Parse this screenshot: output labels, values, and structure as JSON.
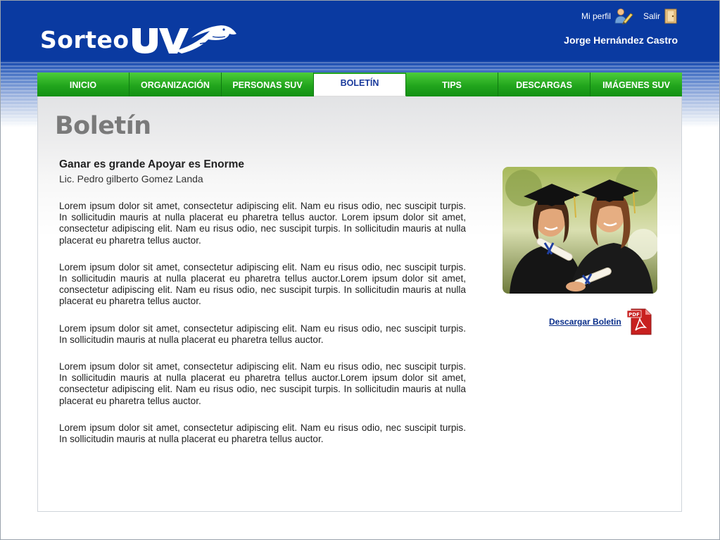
{
  "header": {
    "logo_text": "Sorteo",
    "profile_label": "Mi perfil",
    "logout_label": "Salir",
    "user_name": "Jorge Hernández Castro"
  },
  "nav": {
    "items": [
      {
        "label": "INICIO"
      },
      {
        "label": "ORGANIZACIÓN"
      },
      {
        "label": "PERSONAS SUV"
      },
      {
        "label": "BOLETÍN",
        "active": true
      },
      {
        "label": "TIPS"
      },
      {
        "label": "DESCARGAS"
      },
      {
        "label": "IMÁGENES SUV"
      }
    ]
  },
  "page": {
    "title": "Boletín"
  },
  "article": {
    "title": "Ganar es grande Apoyar es Enorme",
    "author": "Lic. Pedro gilberto Gomez Landa",
    "paragraphs": [
      "Lorem ipsum dolor sit amet, consectetur adipiscing elit. Nam eu risus odio, nec suscipit turpis. In sollicitudin mauris at nulla placerat eu pharetra tellus auctor. Lorem ipsum dolor sit amet, consectetur adipiscing elit. Nam eu risus odio, nec suscipit turpis. In sollicitudin mauris at nulla placerat eu pharetra tellus auctor.",
      "Lorem ipsum dolor sit amet, consectetur adipiscing elit. Nam eu risus odio, nec suscipit turpis. In sollicitudin mauris at nulla placerat eu pharetra tellus auctor.Lorem ipsum dolor sit amet, consectetur adipiscing elit. Nam eu risus odio, nec suscipit turpis. In sollicitudin mauris at nulla placerat eu pharetra tellus auctor.",
      "Lorem ipsum dolor sit amet, consectetur adipiscing elit. Nam eu risus odio, nec suscipit turpis. In sollicitudin mauris at nulla placerat eu pharetra tellus auctor.",
      "Lorem ipsum dolor sit amet, consectetur adipiscing elit. Nam eu risus odio, nec suscipit turpis. In sollicitudin mauris at nulla placerat eu pharetra tellus auctor.Lorem ipsum dolor sit amet, consectetur adipiscing elit. Nam eu risus odio, nec suscipit turpis. In sollicitudin mauris at nulla placerat eu pharetra tellus auctor.",
      "Lorem ipsum dolor sit amet, consectetur adipiscing elit. Nam eu risus odio, nec suscipit turpis. In sollicitudin mauris at nulla placerat eu pharetra tellus auctor."
    ]
  },
  "sidebar": {
    "download_label": "Descargar Boletin",
    "pdf_icon_text": "PDF"
  },
  "colors": {
    "header_blue": "#0a3aa1",
    "nav_green": "#22a51d",
    "active_text": "#1a3a9c",
    "link": "#0a2f8a"
  },
  "icons": {
    "profile": "user-pencil-icon",
    "logout": "door-icon",
    "download": "pdf-icon"
  }
}
